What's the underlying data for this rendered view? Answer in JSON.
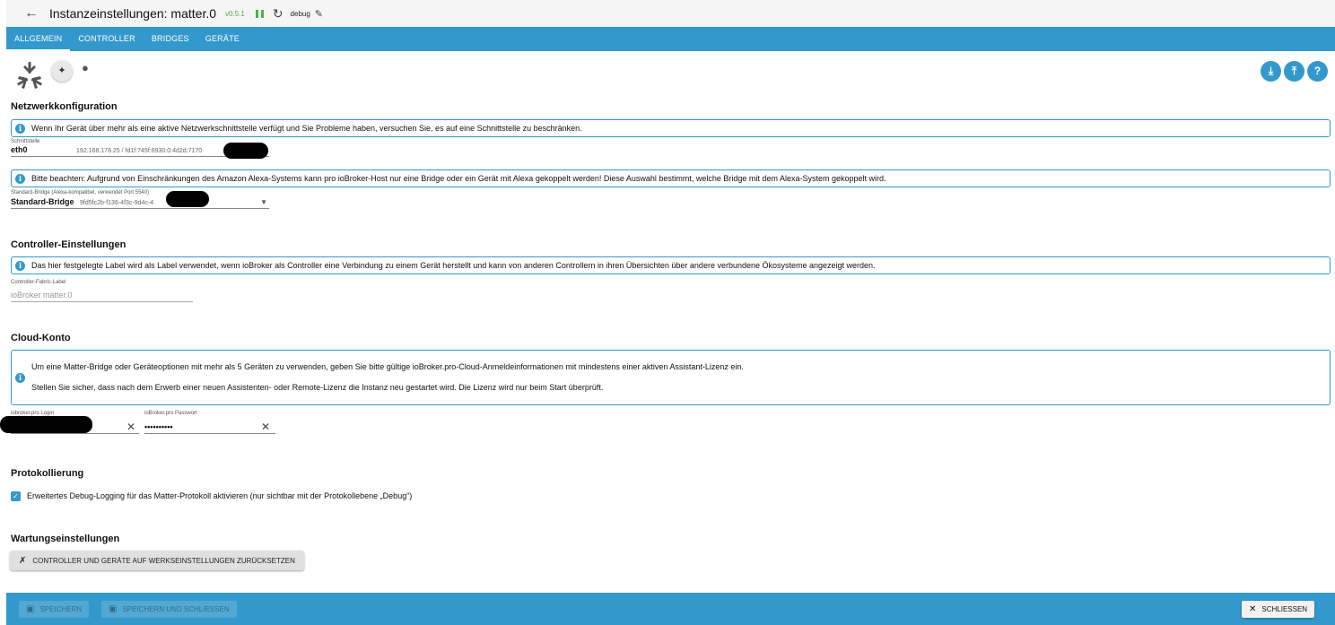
{
  "header": {
    "back_icon": "arrow-left-icon",
    "title": "Instanzeinstellungen: matter.0",
    "version": "v0.5.1",
    "log_level": "debug"
  },
  "tabs": [
    {
      "label": "ALLGEMEIN",
      "active": true
    },
    {
      "label": "CONTROLLER"
    },
    {
      "label": "BRIDGES"
    },
    {
      "label": "GERÄTE"
    }
  ],
  "network": {
    "heading": "Netzwerkkonfiguration",
    "info": "Wenn Ihr Gerät über mehr als eine aktive Netzwerkschnittstelle verfügt und Sie Probleme haben, versuchen Sie, es auf eine Schnittstelle zu beschränken.",
    "interface_label": "Schnittstelle",
    "interface_value": "eth0",
    "interface_address": "192.168.178.25 / fd1f:745f:6930:0:4d2d:7170",
    "alexa_info": "Bitte beachten: Aufgrund von Einschränkungen des Amazon Alexa-Systems kann pro ioBroker-Host nur eine Bridge oder ein Gerät mit Alexa gekoppelt werden! Diese Auswahl bestimmt, welche Bridge mit dem Alexa-System gekoppelt wird.",
    "bridge_label": "Standard-Bridge (Alexa-kompatibel, verwendet Port 5540)",
    "bridge_value": "Standard-Bridge",
    "bridge_id": "9fd5fc2b-f136-4f3c-9d4c-4"
  },
  "controller": {
    "heading": "Controller-Einstellungen",
    "info": "Das hier festgelegte Label wird als Label verwendet, wenn ioBroker als Controller eine Verbindung zu einem Gerät herstellt und kann von anderen Controllern in ihren Übersichten über andere verbundene Ökosysteme angezeigt werden.",
    "fabric_label": "Controller-Fabric-Label",
    "fabric_placeholder": "ioBroker matter.0"
  },
  "cloud": {
    "heading": "Cloud-Konto",
    "info_line1": "Um eine Matter-Bridge oder Geräteoptionen mit mehr als 5 Geräten zu verwenden, geben Sie bitte gültige ioBroker.pro-Cloud-Anmeldeinformationen mit mindestens einer aktiven Assistant-Lizenz ein.",
    "info_line2": "Stellen Sie sicher, dass nach dem Erwerb einer neuen Assistenten- oder Remote-Lizenz die Instanz neu gestartet wird. Die Lizenz wird nur beim Start überprüft.",
    "login_label": "iobroker.pro Login",
    "password_label": "ioBroker.pro Passwort",
    "password_value": "••••••••••"
  },
  "logging": {
    "heading": "Protokollierung",
    "checkbox_label": "Erweitertes Debug-Logging für das Matter-Protokoll aktivieren (nur sichtbar mit der Protokollebene „Debug“)",
    "checked": true
  },
  "maintenance": {
    "heading": "Wartungseinstellungen",
    "reset_button": "CONTROLLER UND GERÄTE AUF WERKSEINSTELLUNGEN ZURÜCKSETZEN"
  },
  "footer": {
    "save": "SPEICHERN",
    "save_close": "SPEICHERN UND SCHLIESSEN",
    "close": "SCHLIESSEN"
  },
  "colors": {
    "accent": "#3399cc",
    "running": "#4caf50"
  }
}
